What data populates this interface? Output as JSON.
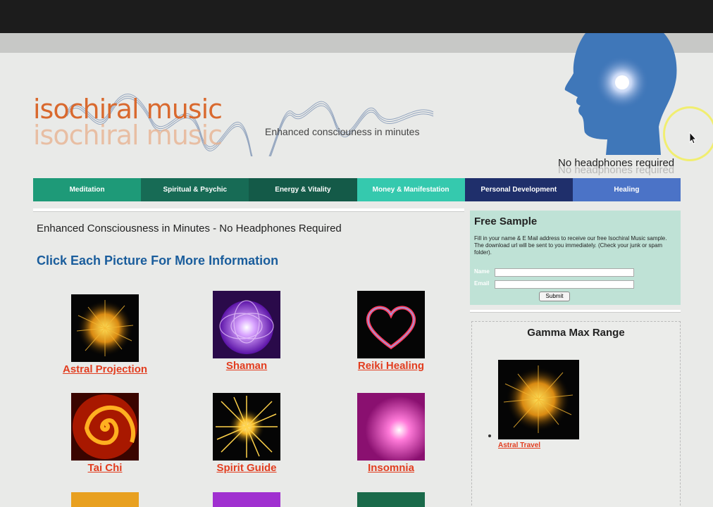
{
  "site": {
    "logo": "isochiral music",
    "tagline": "Enhanced consciouness in minutes",
    "headphones_note": "No headphones required"
  },
  "nav": [
    {
      "label": "Meditation",
      "color": "#1e9a78"
    },
    {
      "label": "Spiritual & Psychic",
      "color": "#176b55"
    },
    {
      "label": "Energy & Vitality",
      "color": "#145a48"
    },
    {
      "label": "Money & Manifestation",
      "color": "#35c9ae"
    },
    {
      "label": "Personal Development",
      "color": "#1f2f6b"
    },
    {
      "label": "Healing",
      "color": "#4b73c7"
    }
  ],
  "main": {
    "intro": "Enhanced Consciousness in Minutes - No Headphones Required",
    "heading": "Click Each Picture For More Information",
    "items": [
      {
        "label": "Astral Projection",
        "icon": "golden-starburst-image"
      },
      {
        "label": "Shaman",
        "icon": "purple-vortex-image"
      },
      {
        "label": "Reiki Healing",
        "icon": "neon-heart-image"
      },
      {
        "label": "Tai Chi",
        "icon": "orange-spiral-image"
      },
      {
        "label": "Spirit Guide",
        "icon": "star-burst-image"
      },
      {
        "label": "Insomnia",
        "icon": "pink-glow-image"
      }
    ]
  },
  "free_sample": {
    "title": "Free Sample",
    "description": "Fill in your name & E Mail address to receive our free Isochiral Music sample. The download url will be sent to you immediately. (Check your junk or spam folder).",
    "name_label": "Name",
    "email_label": "Email",
    "submit_label": "Submit"
  },
  "gamma": {
    "title": "Gamma Max Range",
    "item_label": "Astral Travel"
  }
}
